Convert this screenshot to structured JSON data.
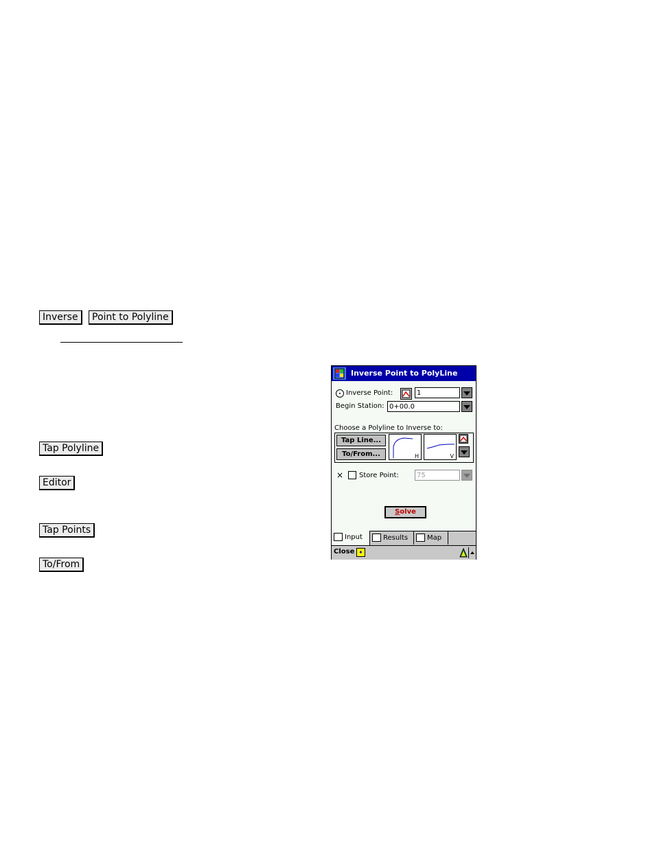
{
  "doc": {
    "heading_buttons": [
      "Inverse",
      "Point to Polyline"
    ],
    "side_buttons": {
      "tap_polyline": "Tap Polyline",
      "editor": "Editor",
      "tap_points": "Tap Points",
      "to_from": "To/From"
    }
  },
  "pda": {
    "title": "Inverse Point to PolyLine",
    "inverse_point_label": "Inverse Point:",
    "inverse_point_value": "1",
    "begin_station_label": "Begin Station:",
    "begin_station_value": "0+00.0",
    "choose_label": "Choose a Polyline to Inverse to:",
    "tap_line_button": "Tap Line...",
    "to_from_button": "To/From...",
    "preview_h_tag": "H",
    "preview_v_tag": "V",
    "store_point_label": "Store Point:",
    "store_point_value": "75",
    "x_mark": "×",
    "solve_first": "S",
    "solve_rest": "olve",
    "tabs": [
      {
        "label": "Input",
        "icon": "input-form-icon",
        "active": true
      },
      {
        "label": "Results",
        "icon": "results-doc-icon",
        "active": false
      },
      {
        "label": "Map",
        "icon": "map-icon",
        "active": false
      }
    ],
    "close_label": "Close",
    "sip_glyph": "✦",
    "colors": {
      "titlebar": "#0000a8",
      "solve_text": "#c00000",
      "preview_curve": "#0000c0"
    }
  }
}
